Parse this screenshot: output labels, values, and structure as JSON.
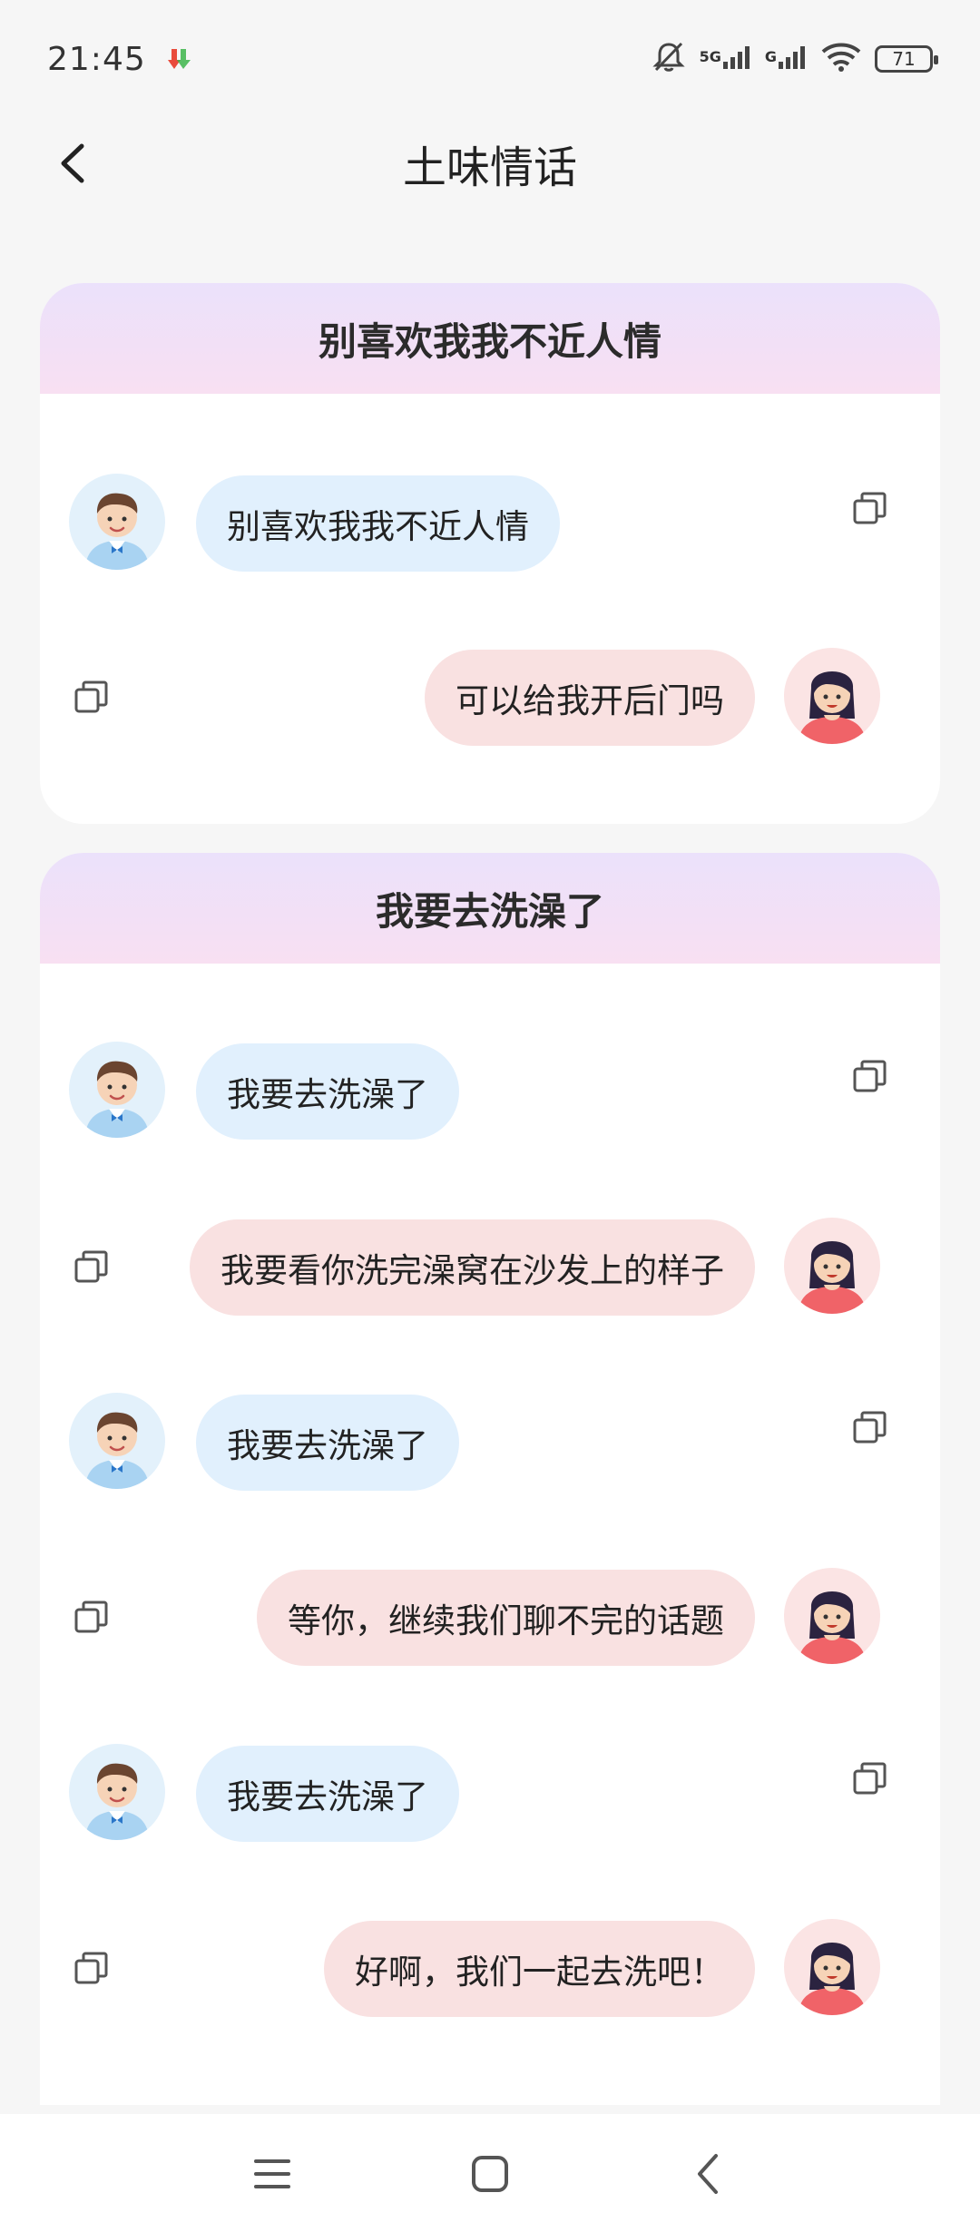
{
  "status": {
    "time": "21:45",
    "net1": "5G",
    "net2": "G",
    "battery": "71"
  },
  "header": {
    "title": "土味情话"
  },
  "cards": [
    {
      "title": "别喜欢我我不近人情",
      "messages": [
        {
          "from": "boy",
          "text": "别喜欢我我不近人情"
        },
        {
          "from": "girl",
          "text": "可以给我开后门吗"
        }
      ]
    },
    {
      "title": "我要去洗澡了",
      "messages": [
        {
          "from": "boy",
          "text": "我要去洗澡了"
        },
        {
          "from": "girl",
          "text": "我要看你洗完澡窝在沙发上的样子"
        },
        {
          "from": "boy",
          "text": "我要去洗澡了"
        },
        {
          "from": "girl",
          "text": "等你，继续我们聊不完的话题"
        },
        {
          "from": "boy",
          "text": "我要去洗澡了"
        },
        {
          "from": "girl",
          "text": "好啊，我们一起去洗吧！"
        }
      ]
    }
  ],
  "icons": {
    "back": "chevron-left-icon",
    "copy": "copy-icon",
    "boy_avatar": "boy-avatar",
    "girl_avatar": "girl-avatar"
  }
}
